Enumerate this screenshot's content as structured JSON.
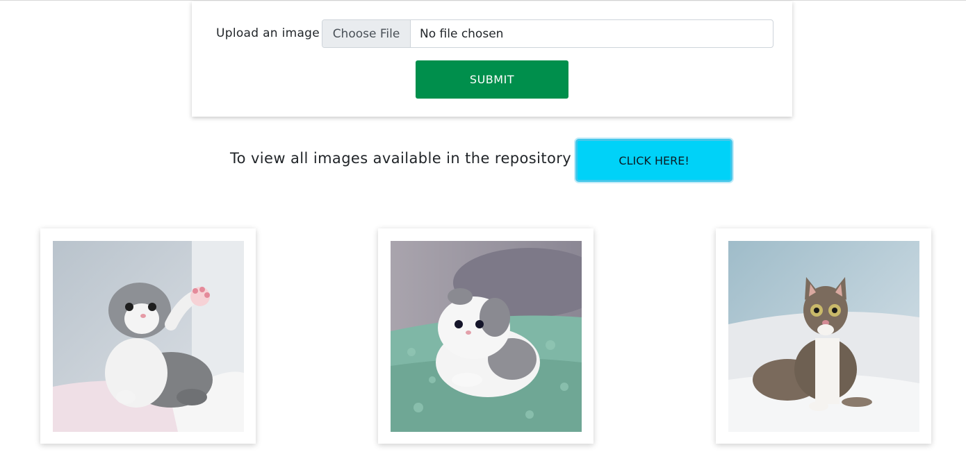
{
  "upload": {
    "label": "Upload an image",
    "choose_file_label": "Choose File",
    "file_status": "No file chosen",
    "submit_label": "SUBMIT"
  },
  "repository": {
    "prompt": "To view all images available in the repository",
    "button_label": "CLICK HERE!"
  },
  "gallery": {
    "images": [
      {
        "subject": "grey and white fluffy kitten raising paw"
      },
      {
        "subject": "white and grey kitten lying on teal rug"
      },
      {
        "subject": "tabby cat with white chest lying on bed"
      }
    ]
  },
  "colors": {
    "submit": "#008f4c",
    "click_here": "#00d2f8"
  }
}
